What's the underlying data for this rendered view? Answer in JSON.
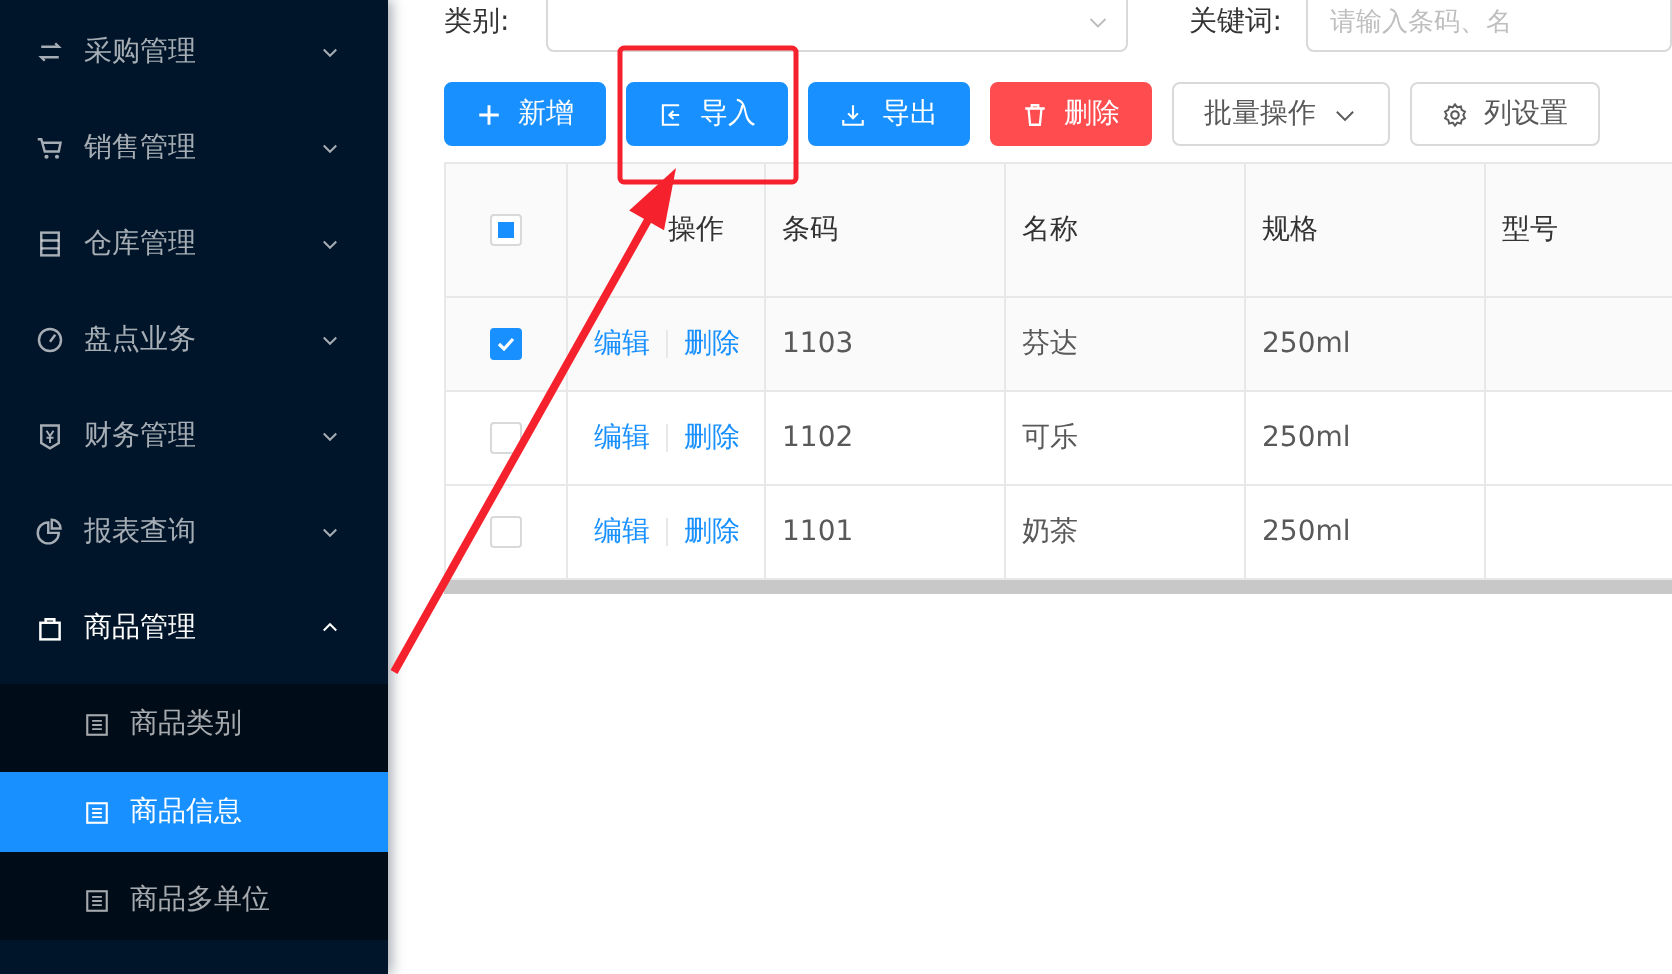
{
  "sidebar": {
    "items": [
      {
        "label": "采购管理",
        "expanded": false
      },
      {
        "label": "销售管理",
        "expanded": false
      },
      {
        "label": "仓库管理",
        "expanded": false
      },
      {
        "label": "盘点业务",
        "expanded": false
      },
      {
        "label": "财务管理",
        "expanded": false
      },
      {
        "label": "报表查询",
        "expanded": false
      },
      {
        "label": "商品管理",
        "expanded": true,
        "children": [
          {
            "label": "商品类别",
            "selected": false
          },
          {
            "label": "商品信息",
            "selected": true
          },
          {
            "label": "商品多单位",
            "selected": false
          }
        ]
      }
    ]
  },
  "filters": [
    {
      "label": "类别:",
      "kind": "select"
    },
    {
      "label": "关键词:",
      "kind": "input",
      "placeholder": "请输入条码、名"
    }
  ],
  "toolbar": [
    {
      "label": "新增",
      "kind": "primary"
    },
    {
      "label": "导入",
      "kind": "primary"
    },
    {
      "label": "导出",
      "kind": "primary"
    },
    {
      "label": "删除",
      "kind": "danger"
    },
    {
      "label": "批量操作",
      "kind": "dropdown"
    },
    {
      "label": "列设置",
      "kind": "default"
    }
  ],
  "table": {
    "select_all": {
      "checked": false,
      "indeterminate": true
    },
    "action_column": "操作",
    "columns": [
      "条码",
      "名称",
      "规格",
      "型号"
    ],
    "rows": [
      {
        "selected": true,
        "actions": [
          "编辑",
          "删除"
        ],
        "cells": [
          "1103",
          "芬达",
          "250ml"
        ]
      },
      {
        "selected": false,
        "actions": [
          "编辑",
          "删除"
        ],
        "cells": [
          "1102",
          "可乐",
          "250ml"
        ]
      },
      {
        "selected": false,
        "actions": [
          "编辑",
          "删除"
        ],
        "cells": [
          "1101",
          "奶茶",
          "250ml"
        ]
      }
    ]
  }
}
